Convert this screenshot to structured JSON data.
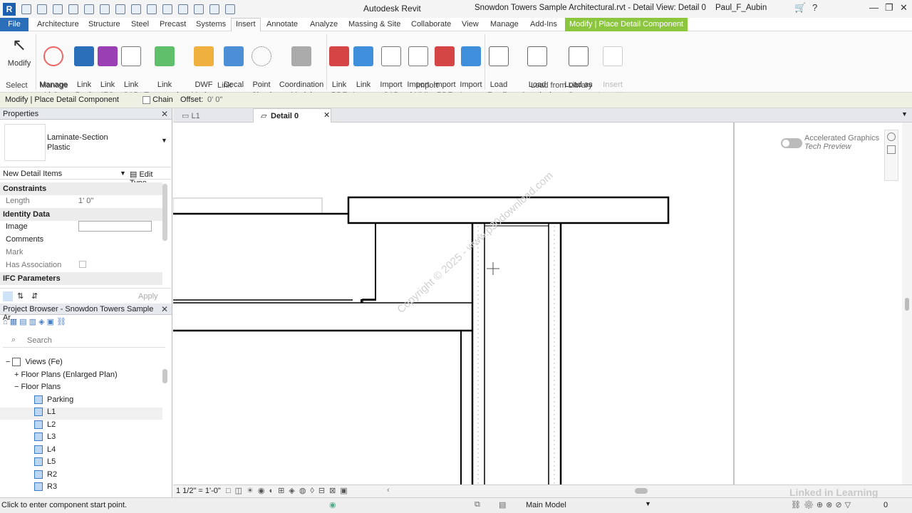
{
  "titlebar": {
    "app_name": "Autodesk Revit",
    "document": "Snowdon Towers Sample Architectural.rvt - Detail View: Detail 0",
    "user": "Paul_F_Aubin"
  },
  "tabs": {
    "file": "File",
    "items": [
      "Architecture",
      "Structure",
      "Steel",
      "Precast",
      "Systems",
      "Insert",
      "Annotate",
      "Analyze",
      "Massing & Site",
      "Collaborate",
      "View",
      "Manage",
      "Add-Ins"
    ],
    "contextual": "Modify | Place Detail Component"
  },
  "ribbon": {
    "select": {
      "modify": "Modify",
      "panel": "Select"
    },
    "link": {
      "manage_links": "Manage\nLinks",
      "link_revit": "Link\nRevit",
      "link_ifc": "Link\nIFC",
      "link_cad": "Link\nCAD",
      "link_topography": "Link\nTopography",
      "dwf_markup": "DWF\nMarkup",
      "decal": "Decal",
      "point_cloud": "Point\nCloud",
      "coordination_model": "Coordination\nModel",
      "panel_manage": "Manage",
      "panel": "Link"
    },
    "import": {
      "link_pdf": "Link\nPDF",
      "link_image": "Link\nImage",
      "import_cad": "Import\nCAD",
      "import_gbxml": "Import\ngbXML",
      "import_pdf": "Import\nPDF",
      "import_image": "Import\nImage",
      "panel": "Import"
    },
    "library": {
      "load_family": "Load\nFamily",
      "load_autodesk_family": "Load Autodesk\nFamily",
      "load_as_group": "Load as\nGroup",
      "insert_from_file": "Insert\nfrom File",
      "panel": "Load from Library"
    }
  },
  "options_bar": {
    "context": "Modify | Place Detail Component",
    "chain": "Chain",
    "offset_label": "Offset:",
    "offset_value": "0'  0\""
  },
  "properties": {
    "title": "Properties",
    "type_name_1": "Laminate-Section",
    "type_name_2": "Plastic",
    "instance_selector": "New Detail Items",
    "edit_type": "Edit Type",
    "groups": {
      "constraints": "Constraints",
      "identity": "Identity Data",
      "ifc": "IFC Parameters"
    },
    "rows": {
      "length_k": "Length",
      "length_v": "1'  0\"",
      "image_k": "Image",
      "comments_k": "Comments",
      "mark_k": "Mark",
      "has_assoc_k": "Has Association"
    },
    "apply": "Apply"
  },
  "browser": {
    "title": "Project Browser - Snowdon Towers Sample Ar...",
    "search_placeholder": "Search",
    "views": "Views (Fe)",
    "floor_enlarged": "Floor Plans (Enlarged Plan)",
    "floor_plans": "Floor Plans",
    "levels": [
      "Parking",
      "L1",
      "L2",
      "L3",
      "L4",
      "L5",
      "R2",
      "R3"
    ]
  },
  "view_tabs": {
    "tab1": "L1",
    "tab2": "Detail 0"
  },
  "canvas": {
    "accelerated_1": "Accelerated Graphics",
    "accelerated_2": "Tech Preview",
    "watermark": "Copyright © 2025 - www.p30download.com"
  },
  "viewbar": {
    "scale": "1 1/2\" = 1'-0\""
  },
  "statusbar": {
    "hint": "Click to enter component start point.",
    "model": "Main Model",
    "counter": "0",
    "brand": "Linked in Learning"
  }
}
